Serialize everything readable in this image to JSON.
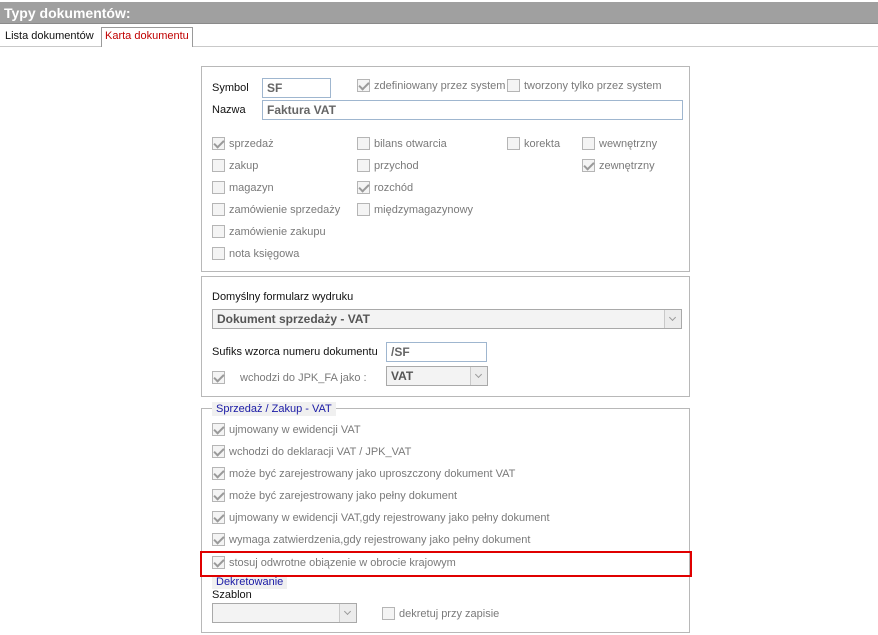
{
  "window": {
    "title": "Typy dokumentów:"
  },
  "tabs": [
    {
      "label": "Lista dokumentów"
    },
    {
      "label": "Karta dokumentu"
    }
  ],
  "general": {
    "symbol_label": "Symbol",
    "symbol_value": "SF",
    "name_label": "Nazwa",
    "name_value": "Faktura VAT",
    "system_defined": {
      "label": "zdefiniowany przez system",
      "checked": true
    },
    "system_created_only": {
      "label": "tworzony tylko przez system",
      "checked": false
    },
    "types": [
      {
        "label": "sprzedaż",
        "checked": true
      },
      {
        "label": "zakup",
        "checked": false
      },
      {
        "label": "magazyn",
        "checked": false
      },
      {
        "label": "zamówienie sprzedaży",
        "checked": false
      },
      {
        "label": "zamówienie zakupu",
        "checked": false
      },
      {
        "label": "nota księgowa",
        "checked": false
      },
      {
        "label": "bilans otwarcia",
        "checked": false
      },
      {
        "label": "przychod",
        "checked": false
      },
      {
        "label": "rozchód",
        "checked": true
      },
      {
        "label": "międzymagazynowy",
        "checked": false
      },
      {
        "label": "korekta",
        "checked": false
      },
      {
        "label": "wewnętrzny",
        "checked": false
      },
      {
        "label": "zewnętrzny",
        "checked": true
      }
    ]
  },
  "print": {
    "form_label": "Domyślny formularz wydruku",
    "form_value": "Dokument sprzedaży - VAT",
    "suffix_label": "Sufiks wzorca numeru dokumentu",
    "suffix_value": "/SF",
    "jpk_label": "wchodzi do JPK_FA jako :",
    "jpk_checked": true,
    "jpk_value": "VAT"
  },
  "vat": {
    "legend": "Sprzedaż / Zakup - VAT",
    "options": [
      {
        "label": "ujmowany w ewidencji VAT",
        "checked": true
      },
      {
        "label": "wchodzi do deklaracji VAT  / JPK_VAT",
        "checked": true
      },
      {
        "label": "może być zarejestrowany jako uproszczony dokument VAT",
        "checked": true
      },
      {
        "label": "może być zarejestrowany jako pełny dokument",
        "checked": true
      },
      {
        "label": "ujmowany w ewidencji VAT,gdy rejestrowany jako pełny dokument",
        "checked": true
      },
      {
        "label": "wymaga zatwierdzenia,gdy rejestrowany jako pełny dokument",
        "checked": true
      },
      {
        "label": "stosuj odwrotne obiązenie w obrocie krajowym",
        "checked": true
      }
    ]
  },
  "decree": {
    "legend": "Dekretowanie",
    "template_label": "Szablon",
    "template_value": "",
    "on_save": {
      "label": "dekretuj przy zapisie",
      "checked": false
    }
  },
  "colors": {
    "highlight": "#e00000",
    "title_bar": "#a0a0a0",
    "legend_text": "#1a1aa6",
    "active_tab_text": "#c00000"
  }
}
